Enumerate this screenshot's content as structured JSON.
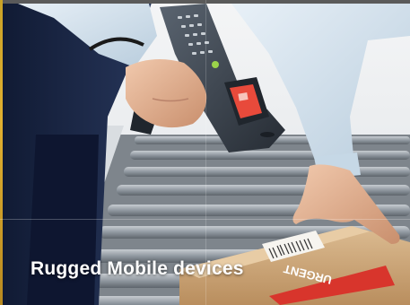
{
  "banner": {
    "caption": "Rugged Mobile devices",
    "label_text": "URGENT",
    "colors": {
      "sleeve": "#dbe8f3",
      "suit": "#1b2747",
      "device": "#3c4552",
      "screen": "#e84a3b",
      "box": "#cfa87a",
      "label": "#d8352c",
      "roller": "#9aa1a8"
    }
  },
  "icons": [
    "handheld-scanner-icon",
    "barcode-icon"
  ]
}
